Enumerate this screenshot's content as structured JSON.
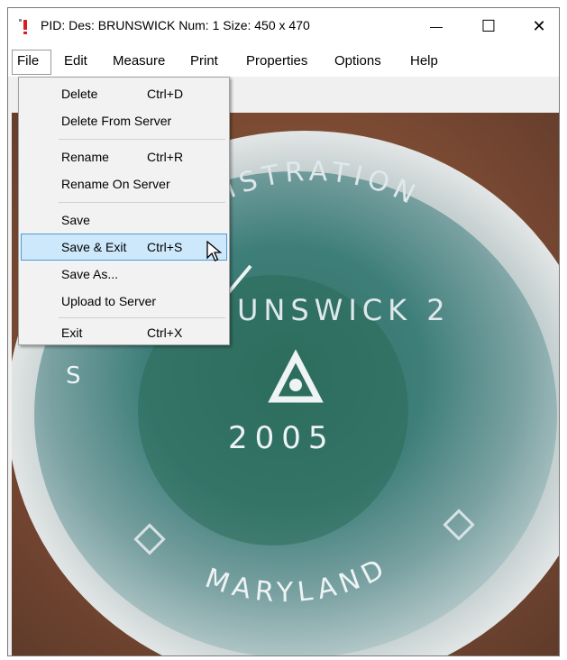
{
  "window": {
    "title": "PID:  Des: BRUNSWICK  Num: 1  Size: 450 x 470",
    "minimize_glyph": "—",
    "maximize_glyph": "☐",
    "close_glyph": "✕"
  },
  "menubar": {
    "file": "File",
    "edit": "Edit",
    "measure": "Measure",
    "print": "Print",
    "properties": "Properties",
    "options": "Options",
    "help": "Help"
  },
  "file_menu": {
    "delete": {
      "label": "Delete",
      "shortcut": "Ctrl+D"
    },
    "delete_from_server": {
      "label": "Delete From Server"
    },
    "rename": {
      "label": "Rename",
      "shortcut": "Ctrl+R"
    },
    "rename_on_server": {
      "label": "Rename On Server"
    },
    "save": {
      "label": "Save"
    },
    "save_exit": {
      "label": "Save & Exit",
      "shortcut": "Ctrl+S"
    },
    "save_as": {
      "label": "Save As..."
    },
    "upload_to_server": {
      "label": "Upload to Server"
    },
    "exit": {
      "label": "Exit",
      "shortcut": "Ctrl+X"
    },
    "highlighted_item": "Save & Exit"
  },
  "photo": {
    "arc_text_top": "ADMINISTRATION",
    "station_text": "UNSWICK 2",
    "year_text": "2005",
    "state_text": "MARYLAND",
    "left_fragment": "S"
  },
  "colors": {
    "highlight_fill": "#cde8fb",
    "highlight_border": "#4a9bd8",
    "icon_red": "#d81e1e"
  }
}
